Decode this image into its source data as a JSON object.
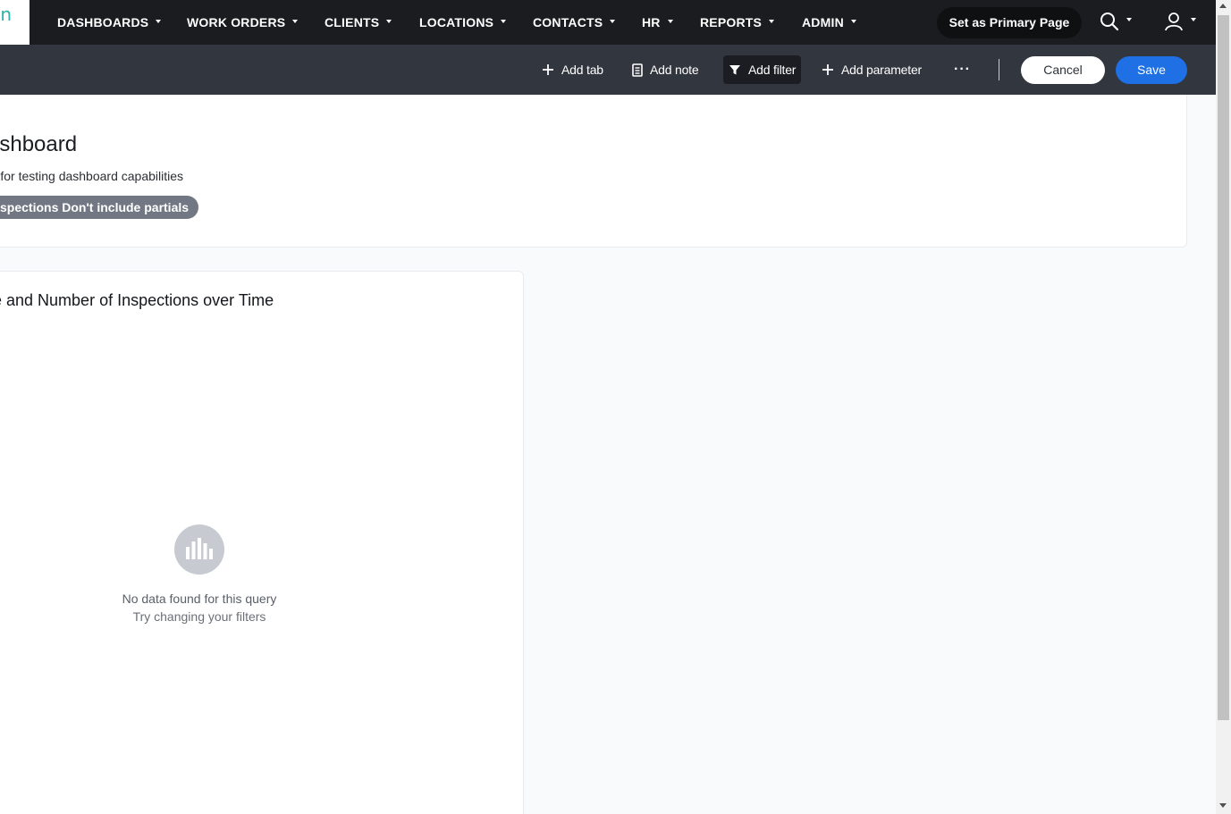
{
  "nav": {
    "items": [
      {
        "label": "DASHBOARDS"
      },
      {
        "label": "WORK ORDERS"
      },
      {
        "label": "CLIENTS"
      },
      {
        "label": "LOCATIONS"
      },
      {
        "label": "CONTACTS"
      },
      {
        "label": "HR"
      },
      {
        "label": "REPORTS"
      },
      {
        "label": "ADMIN"
      }
    ],
    "primary_page_label": "Set as Primary Page",
    "logo_icon": "logo-icon",
    "search_icon": "search-icon",
    "user_icon": "user-icon"
  },
  "toolbar": {
    "add_tab": "Add tab",
    "add_note": "Add note",
    "add_filter": "Add filter",
    "add_parameter": "Add parameter",
    "more": "···",
    "cancel": "Cancel",
    "save": "Save"
  },
  "dashboard": {
    "title": "ashboard",
    "description": "rd for testing dashboard capabilities",
    "filter_chip": "spections Don't include partials"
  },
  "card": {
    "title": "e and Number of Inspections over Time",
    "empty_icon": "bar-chart-icon",
    "empty_title": "No data found for this query",
    "empty_hint": "Try changing your filters"
  },
  "colors": {
    "nav_bg": "#1a1c1f",
    "toolbar_bg": "#32363f",
    "save_blue": "#1f6fe5",
    "pill_gray": "#717783",
    "page_bg": "#f8fafc"
  }
}
